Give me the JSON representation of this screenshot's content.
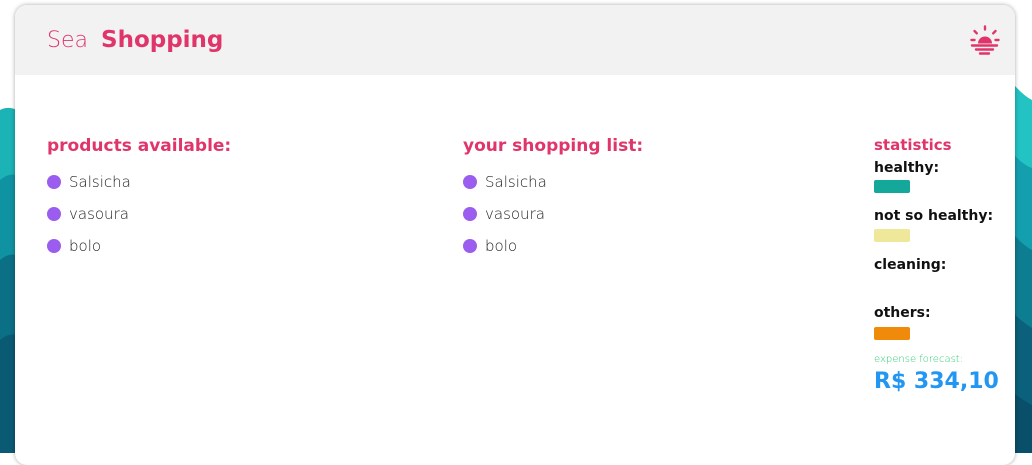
{
  "header": {
    "brand_light": "Sea",
    "brand_bold": "Shopping",
    "theme_icon": "sun-icon"
  },
  "colors": {
    "accent": "#e0356a",
    "bullet": "#9b5cf0",
    "healthy": "#14a89a",
    "not_so_healthy": "#efe89a",
    "others": "#f08a0a",
    "forecast_label": "#2ecc71",
    "forecast_value": "#2196f3",
    "background_waves": "#0b8a9a"
  },
  "available": {
    "title": "products available:",
    "items": [
      "Salsicha",
      "vasoura",
      "bolo"
    ]
  },
  "shopping_list": {
    "title": "your shopping list:",
    "items": [
      "Salsicha",
      "vasoura",
      "bolo"
    ]
  },
  "statistics": {
    "title": "statistics",
    "healthy_label": "healthy:",
    "not_so_healthy_label": "not so healthy:",
    "cleaning_label": "cleaning:",
    "others_label": "others:",
    "forecast_label": "expense forecast:",
    "forecast_value": "R$ 334,10"
  }
}
